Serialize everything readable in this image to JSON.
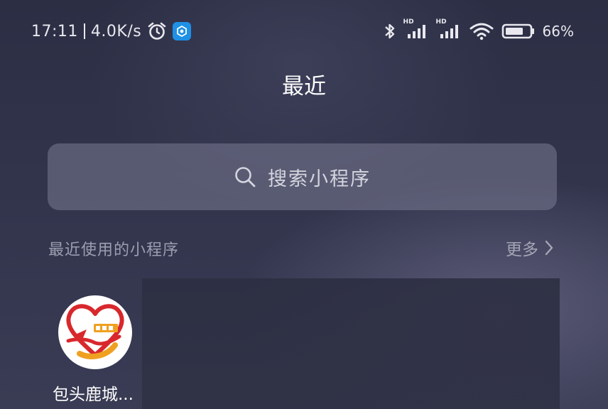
{
  "status_bar": {
    "time": "17:11",
    "network_speed": "4.0K/s",
    "battery_percent": "66%",
    "signal_1_label": "HD",
    "signal_2_label": "HD",
    "icons": [
      "alarm-icon",
      "app-badge-icon",
      "bluetooth-icon",
      "signal-icon",
      "signal-icon",
      "wifi-icon",
      "battery-icon"
    ]
  },
  "page": {
    "title": "最近"
  },
  "search": {
    "placeholder": "搜索小程序",
    "icon": "search-icon"
  },
  "recent_section": {
    "label": "最近使用的小程序",
    "more_label": "更多",
    "more_icon": "chevron-right-icon"
  },
  "mini_programs": [
    {
      "label": "包头鹿城...",
      "icon": "heart-logo-icon"
    }
  ],
  "colors": {
    "background": "#2f3149",
    "search_bg": "#6f7189",
    "logo_red": "#d8282c",
    "logo_orange": "#f0a020",
    "app_badge": "#1e90e6"
  }
}
